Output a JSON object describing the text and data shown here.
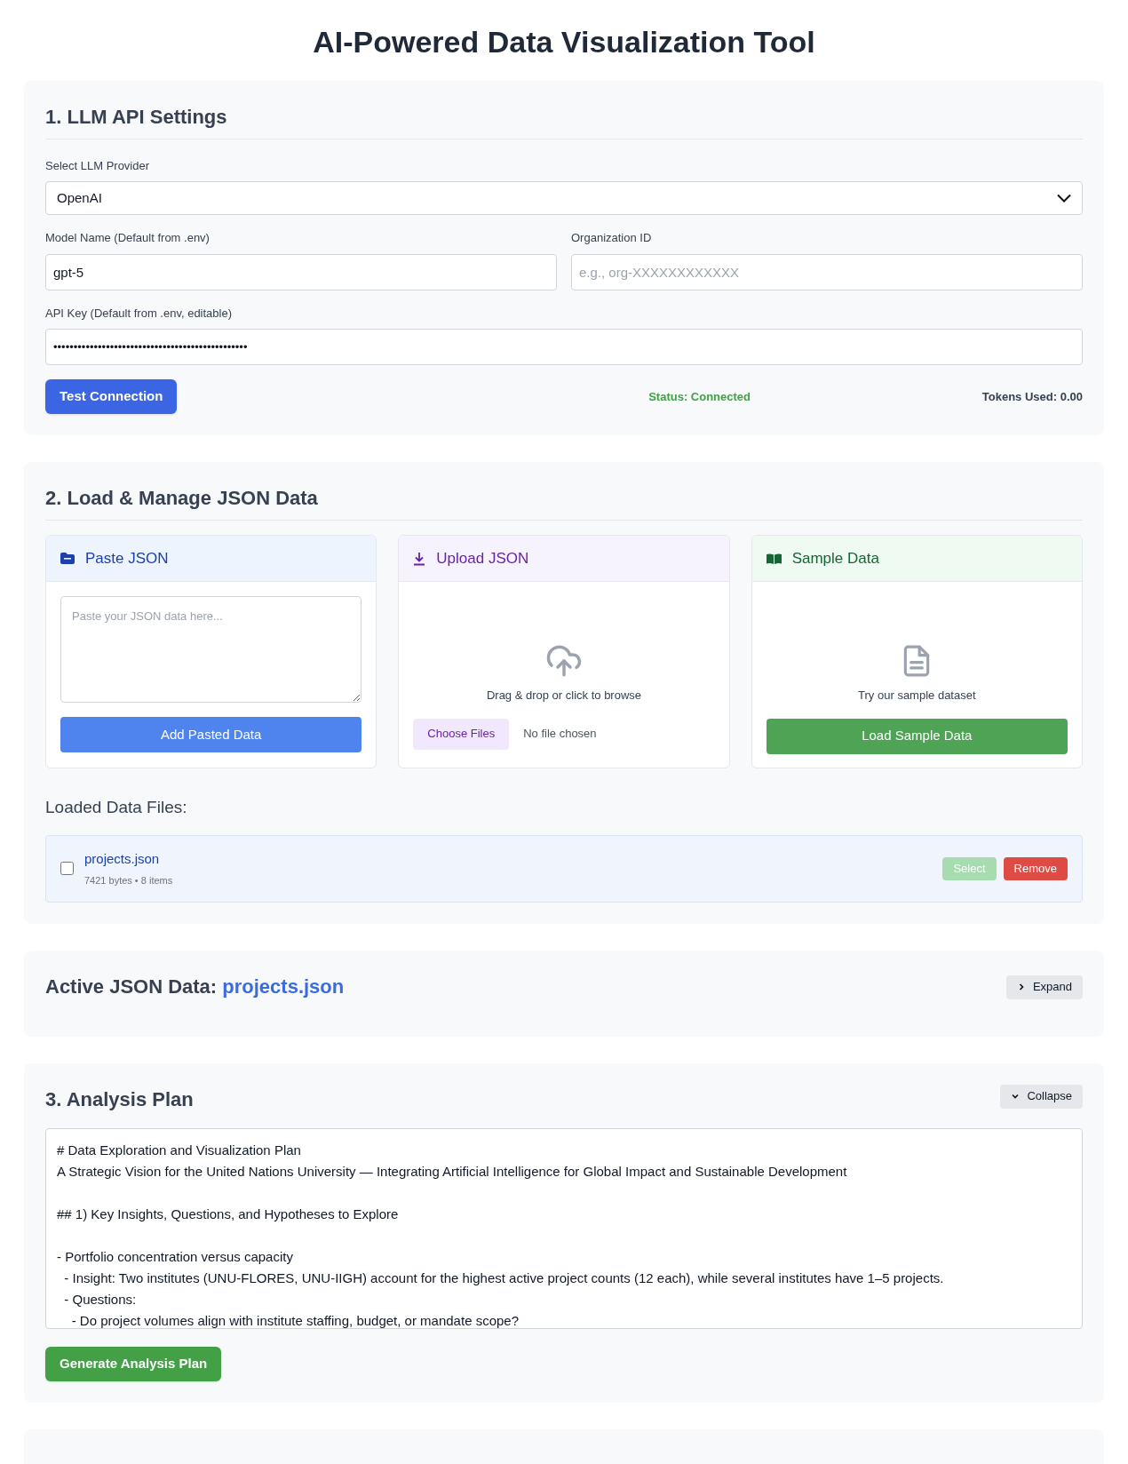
{
  "page_title": "AI-Powered Data Visualization Tool",
  "settings": {
    "heading": "1. LLM API Settings",
    "provider": {
      "label": "Select LLM Provider",
      "value": "OpenAI"
    },
    "model": {
      "label": "Model Name (Default from .env)",
      "value": "gpt-5"
    },
    "organization": {
      "label": "Organization ID",
      "placeholder": "e.g., org-XXXXXXXXXXXX"
    },
    "api_key": {
      "label": "API Key (Default from .env, editable)",
      "value": "••••••••••••••••••••••••••••••••••••••••••••••••"
    },
    "test_button": "Test Connection",
    "status": "Status: Connected",
    "tokens": "Tokens Used: 0.00"
  },
  "load": {
    "heading": "2. Load & Manage JSON Data",
    "cards": [
      {
        "kind": "paste",
        "title": "Paste JSON",
        "placeholder": "Paste your JSON data here...",
        "button": "Add Pasted Data"
      },
      {
        "kind": "upload",
        "title": "Upload JSON",
        "hint": "Drag & drop or click to browse",
        "button": "Choose Files",
        "file_status": "No file chosen"
      },
      {
        "kind": "sample",
        "title": "Sample Data",
        "hint": "Try our sample dataset",
        "button": "Load Sample Data"
      }
    ],
    "files_heading": "Loaded Data Files:",
    "files": [
      {
        "name": "projects.json",
        "meta": "7421 bytes • 8 items",
        "checked": false,
        "select_label": "Select",
        "select_disabled": true,
        "remove_label": "Remove"
      }
    ]
  },
  "active": {
    "label": "Active JSON Data:",
    "file": "projects.json",
    "toggle": "Expand",
    "expanded": false
  },
  "plan": {
    "heading": "3. Analysis Plan",
    "toggle": "Collapse",
    "expanded": true,
    "blocks": [
      [
        "# Data Exploration and Visualization Plan",
        "A Strategic Vision for the United Nations University — Integrating Artificial Intelligence for Global Impact and Sustainable Development"
      ],
      [
        "## 1) Key Insights, Questions, and Hypotheses to Explore"
      ],
      [
        "- Portfolio concentration versus capacity",
        "  - Insight: Two institutes (UNU-FLORES, UNU-IIGH) account for the highest active project counts (12 each), while several institutes have 1–5 projects.",
        "  - Questions:",
        "    - Do project volumes align with institute staffing, budget, or mandate scope?"
      ]
    ],
    "button": "Generate Analysis Plan"
  }
}
